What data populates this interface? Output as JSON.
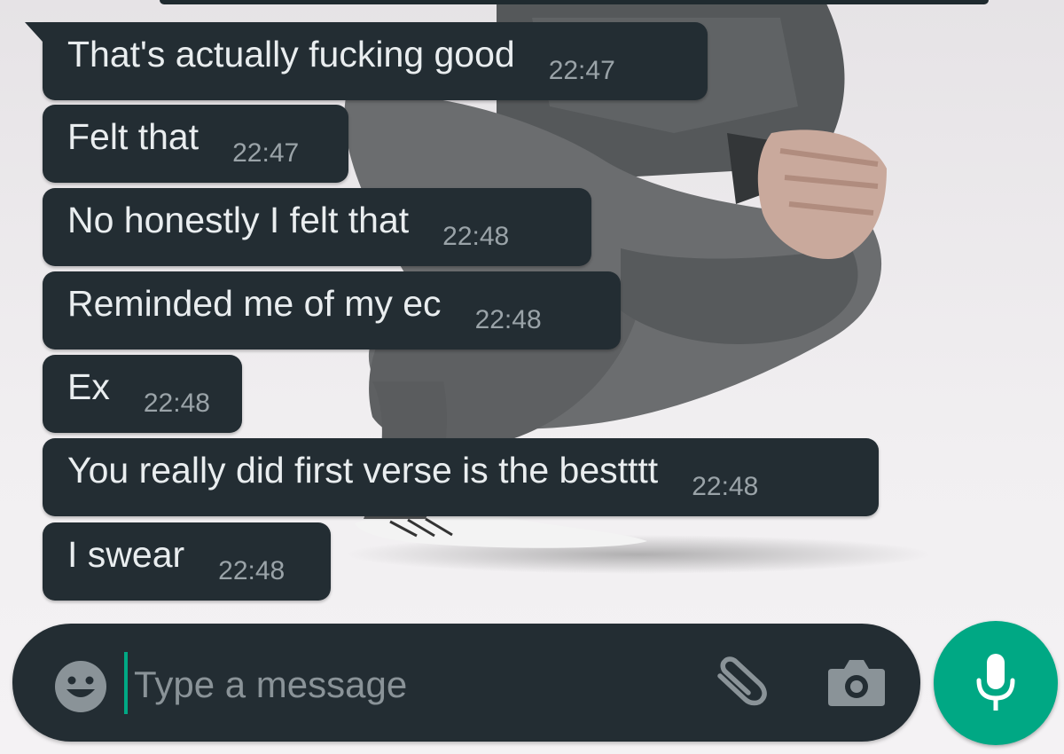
{
  "messages": [
    {
      "text": "That's actually fucking good",
      "time": "22:47"
    },
    {
      "text": "Felt that",
      "time": "22:47"
    },
    {
      "text": "No honestly I felt that",
      "time": "22:48"
    },
    {
      "text": "Reminded me of my ec",
      "time": "22:48"
    },
    {
      "text": "Ex",
      "time": "22:48"
    },
    {
      "text": "You really did first verse is the bestttt",
      "time": "22:48"
    },
    {
      "text": "I swear",
      "time": "22:48"
    }
  ],
  "compose": {
    "placeholder": "Type a message",
    "value": "",
    "icons": {
      "emoji": "emoji-icon",
      "attach": "paperclip-icon",
      "camera": "camera-icon",
      "mic": "microphone-icon"
    }
  },
  "colors": {
    "bubble": "#232d33",
    "text": "#e9edef",
    "timestamp": "#9aa3a8",
    "accent": "#00a884"
  }
}
